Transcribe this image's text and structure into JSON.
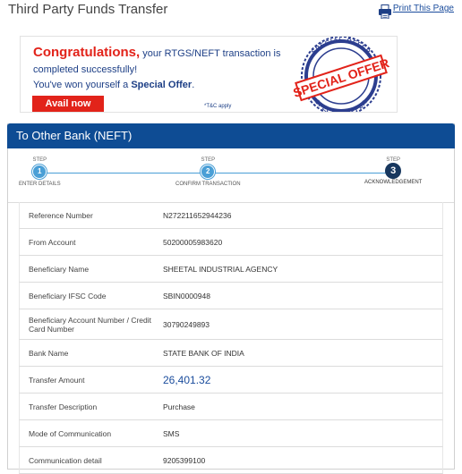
{
  "page": {
    "title": "Third Party Funds Transfer",
    "print_label": "Print This Page"
  },
  "promo": {
    "congrats": "Congratulations,",
    "line1_rest": " your RTGS/NEFT transaction is",
    "line2": "completed successfully!",
    "line3_prefix": "You've won yourself a ",
    "line3_bold": "Special Offer",
    "line3_suffix": ".",
    "button_label": "Avail now",
    "tc": "*T&C apply",
    "seal_text": "SPECIAL OFFER",
    "seal_ring_text": "SPECIAL OFFER"
  },
  "panel": {
    "heading": "To Other Bank (NEFT)"
  },
  "steps": [
    {
      "step_label": "STEP",
      "number": "1",
      "label": "ENTER DETAILS"
    },
    {
      "step_label": "STEP",
      "number": "2",
      "label": "CONFIRM TRANSACTION"
    },
    {
      "step_label": "STEP",
      "number": "3",
      "label": "ACKNOWLEDGEMENT"
    }
  ],
  "details": [
    {
      "label": "Reference Number",
      "value": "N272211652944236"
    },
    {
      "label": "From Account",
      "value": "50200005983620"
    },
    {
      "label": "Beneficiary Name",
      "value": "SHEETAL INDUSTRIAL AGENCY"
    },
    {
      "label": "Beneficiary IFSC Code",
      "value": "SBIN0000948"
    },
    {
      "label": "Beneficiary Account Number / Credit Card Number",
      "value": "30790249893"
    },
    {
      "label": "Bank Name",
      "value": "STATE BANK OF INDIA"
    },
    {
      "label": "Transfer Amount",
      "value": "26,401.32"
    },
    {
      "label": "Transfer Description",
      "value": "Purchase"
    },
    {
      "label": "Mode of Communication",
      "value": "SMS"
    },
    {
      "label": "Communication detail",
      "value": "9205399100"
    }
  ],
  "colors": {
    "header_blue": "#0e4c94",
    "step_blue": "#4a9fd6",
    "step_current": "#17375e",
    "promo_red": "#e2231a",
    "amount_blue": "#1a4c9c"
  }
}
